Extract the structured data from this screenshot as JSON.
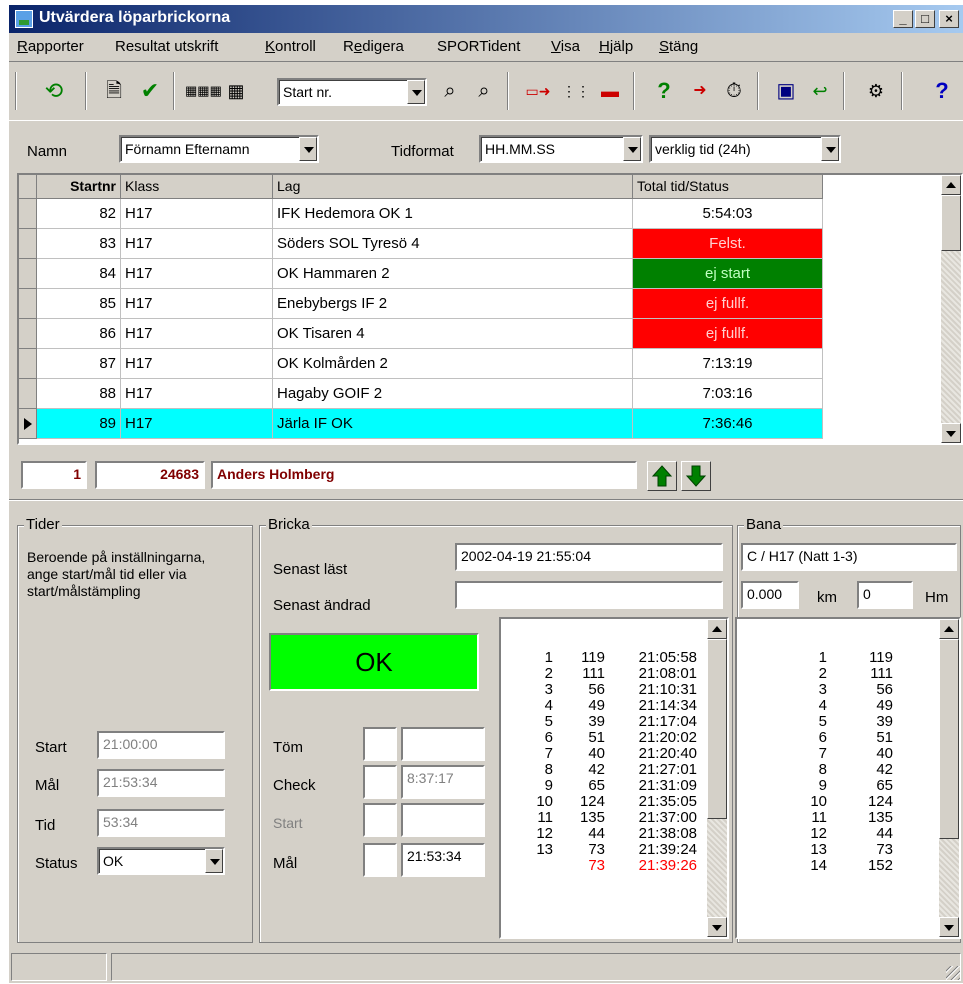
{
  "window": {
    "title": "Utvärdera löparbrickorna"
  },
  "menu": [
    {
      "pre": "",
      "u": "R",
      "post": "apporter"
    },
    {
      "pre": "Resultat utskrift",
      "u": "",
      "post": ""
    },
    {
      "pre": "",
      "u": "K",
      "post": "ontroll"
    },
    {
      "pre": "R",
      "u": "e",
      "post": "digera"
    },
    {
      "pre": "SPORTident",
      "u": "",
      "post": ""
    },
    {
      "pre": "",
      "u": "V",
      "post": "isa"
    },
    {
      "pre": "",
      "u": "H",
      "post": "jälp"
    },
    {
      "pre": "",
      "u": "S",
      "post": "täng"
    }
  ],
  "toolbar": {
    "sort_combo": "Start nr."
  },
  "filters": {
    "namn_label": "Namn",
    "namn_value": "Förnamn Efternamn",
    "tidformat_label": "Tidformat",
    "tidformat_value": "HH.MM.SS",
    "tidtyp_value": "verklig tid (24h)"
  },
  "grid": {
    "headers": [
      "Startnr",
      "Klass",
      "Lag",
      "Total tid/Status"
    ],
    "rows": [
      {
        "startnr": "82",
        "klass": "H17",
        "lag": "IFK Hedemora OK 1",
        "status": "5:54:03",
        "bg": "#ffffff",
        "fg": "#000000"
      },
      {
        "startnr": "83",
        "klass": "H17",
        "lag": "Söders SOL Tyresö 4",
        "status": "Felst.",
        "bg": "#ff0000",
        "fg": "#ffd0d0"
      },
      {
        "startnr": "84",
        "klass": "H17",
        "lag": "OK Hammaren 2",
        "status": "ej start",
        "bg": "#008000",
        "fg": "#c0ffc0"
      },
      {
        "startnr": "85",
        "klass": "H17",
        "lag": "Enebybergs IF 2",
        "status": "ej fullf.",
        "bg": "#ff0000",
        "fg": "#ffd0d0"
      },
      {
        "startnr": "86",
        "klass": "H17",
        "lag": "OK Tisaren 4",
        "status": "ej fullf.",
        "bg": "#ff0000",
        "fg": "#ffd0d0"
      },
      {
        "startnr": "87",
        "klass": "H17",
        "lag": "OK Kolmården 2",
        "status": "7:13:19",
        "bg": "#ffffff",
        "fg": "#000000"
      },
      {
        "startnr": "88",
        "klass": "H17",
        "lag": "Hagaby GOIF 2",
        "status": "7:03:16",
        "bg": "#ffffff",
        "fg": "#000000"
      },
      {
        "startnr": "89",
        "klass": "H17",
        "lag": "Järla IF OK",
        "status": "7:36:46",
        "bg": "#00ffff",
        "fg": "#000000"
      }
    ]
  },
  "runner": {
    "leg": "1",
    "si_number": "24683",
    "name": "Anders Holmberg"
  },
  "tider": {
    "title": "Tider",
    "description": "Beroende på inställningarna, ange start/mål tid eller via start/målstämpling",
    "start_label": "Start",
    "start_value": "21:00:00",
    "mal_label": "Mål",
    "mal_value": "21:53:34",
    "tid_label": "Tid",
    "tid_value": "53:34",
    "status_label": "Status",
    "status_value": "OK"
  },
  "bricka": {
    "title": "Bricka",
    "senast_last_label": "Senast läst",
    "senast_last_value": "2002-04-19 21:55:04",
    "senast_andrad_label": "Senast ändrad",
    "senast_andrad_value": "",
    "ok_label": "OK",
    "tom_label": "Töm",
    "tom_value": "",
    "check_label": "Check",
    "check_value": "8:37:17",
    "start_label": "Start",
    "start_value": "",
    "mal_label": "Mål",
    "mal_value": "21:53:34",
    "punches": [
      {
        "n": "1",
        "code": "119",
        "time": "21:05:58",
        "red": false
      },
      {
        "n": "2",
        "code": "111",
        "time": "21:08:01",
        "red": false
      },
      {
        "n": "3",
        "code": "56",
        "time": "21:10:31",
        "red": false
      },
      {
        "n": "4",
        "code": "49",
        "time": "21:14:34",
        "red": false
      },
      {
        "n": "5",
        "code": "39",
        "time": "21:17:04",
        "red": false
      },
      {
        "n": "6",
        "code": "51",
        "time": "21:20:02",
        "red": false
      },
      {
        "n": "7",
        "code": "40",
        "time": "21:20:40",
        "red": false
      },
      {
        "n": "8",
        "code": "42",
        "time": "21:27:01",
        "red": false
      },
      {
        "n": "9",
        "code": "65",
        "time": "21:31:09",
        "red": false
      },
      {
        "n": "10",
        "code": "124",
        "time": "21:35:05",
        "red": false
      },
      {
        "n": "11",
        "code": "135",
        "time": "21:37:00",
        "red": false
      },
      {
        "n": "12",
        "code": "44",
        "time": "21:38:08",
        "red": false
      },
      {
        "n": "13",
        "code": "73",
        "time": "21:39:24",
        "red": false
      },
      {
        "n": "",
        "code": "73",
        "time": "21:39:26",
        "red": true
      }
    ]
  },
  "bana": {
    "title": "Bana",
    "course": "C / H17 (Natt 1-3)",
    "km_value": "0.000",
    "km_label": "km",
    "hm_value": "0",
    "hm_label": "Hm",
    "controls": [
      {
        "n": "1",
        "code": "119"
      },
      {
        "n": "2",
        "code": "111"
      },
      {
        "n": "3",
        "code": "56"
      },
      {
        "n": "4",
        "code": "49"
      },
      {
        "n": "5",
        "code": "39"
      },
      {
        "n": "6",
        "code": "51"
      },
      {
        "n": "7",
        "code": "40"
      },
      {
        "n": "8",
        "code": "42"
      },
      {
        "n": "9",
        "code": "65"
      },
      {
        "n": "10",
        "code": "124"
      },
      {
        "n": "11",
        "code": "135"
      },
      {
        "n": "12",
        "code": "44"
      },
      {
        "n": "13",
        "code": "73"
      },
      {
        "n": "14",
        "code": "152"
      }
    ]
  },
  "colors": {
    "ok_green": "#00ff00",
    "text_red": "#ff0000",
    "runner_text": "#800000"
  }
}
